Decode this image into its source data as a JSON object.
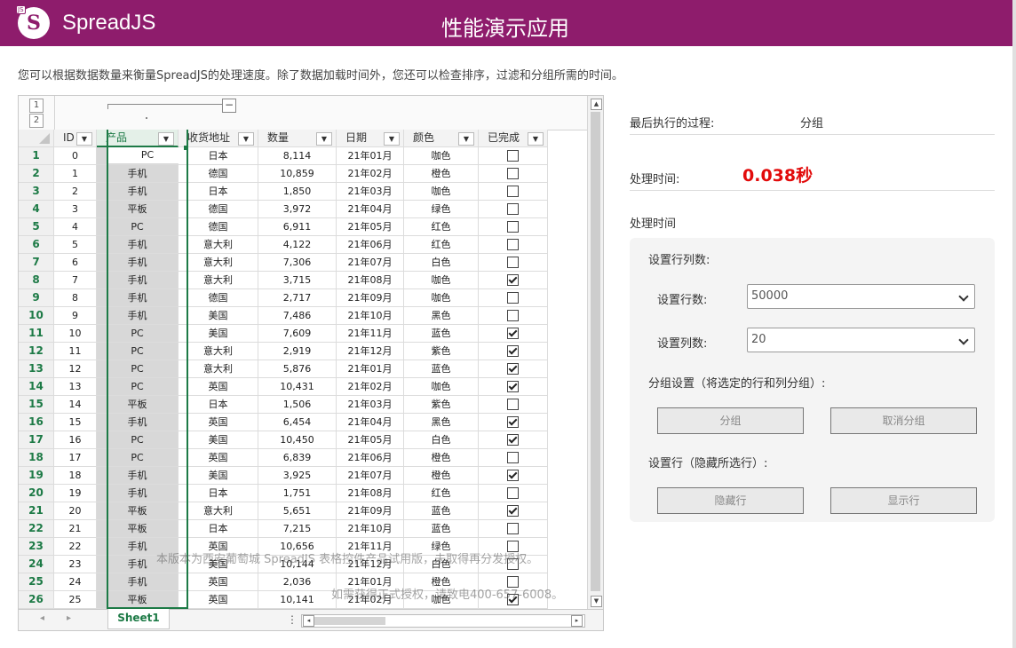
{
  "header": {
    "brand": "SpreadJS",
    "logo_badge": "JS",
    "logo_letter": "S",
    "title": "性能演示应用"
  },
  "description": "您可以根据数据数量来衡量SpreadJS的处理速度。除了数据加载时间外，您还可以检查排序，过滤和分组所需的时间。",
  "spread": {
    "group_levels": [
      "1",
      "2"
    ],
    "group_collapse": "−",
    "columns": [
      "ID",
      "产品",
      "收货地址",
      "数量",
      "日期",
      "颜色",
      "已完成"
    ],
    "selected_column": 1,
    "filter_glyph": "▼",
    "active_cell": "PC",
    "rows": [
      [
        "1",
        "0",
        "PC",
        "日本",
        "8,114",
        "21年01月",
        "咖色",
        false
      ],
      [
        "2",
        "1",
        "手机",
        "德国",
        "10,859",
        "21年02月",
        "橙色",
        false
      ],
      [
        "3",
        "2",
        "手机",
        "日本",
        "1,850",
        "21年03月",
        "咖色",
        false
      ],
      [
        "4",
        "3",
        "平板",
        "德国",
        "3,972",
        "21年04月",
        "绿色",
        false
      ],
      [
        "5",
        "4",
        "PC",
        "德国",
        "6,911",
        "21年05月",
        "红色",
        false
      ],
      [
        "6",
        "5",
        "手机",
        "意大利",
        "4,122",
        "21年06月",
        "红色",
        false
      ],
      [
        "7",
        "6",
        "手机",
        "意大利",
        "7,306",
        "21年07月",
        "白色",
        false
      ],
      [
        "8",
        "7",
        "手机",
        "意大利",
        "3,715",
        "21年08月",
        "咖色",
        true
      ],
      [
        "9",
        "8",
        "手机",
        "德国",
        "2,717",
        "21年09月",
        "咖色",
        false
      ],
      [
        "10",
        "9",
        "手机",
        "美国",
        "7,486",
        "21年10月",
        "黑色",
        false
      ],
      [
        "11",
        "10",
        "PC",
        "美国",
        "7,609",
        "21年11月",
        "蓝色",
        true
      ],
      [
        "12",
        "11",
        "PC",
        "意大利",
        "2,919",
        "21年12月",
        "紫色",
        true
      ],
      [
        "13",
        "12",
        "PC",
        "意大利",
        "5,876",
        "21年01月",
        "蓝色",
        true
      ],
      [
        "14",
        "13",
        "PC",
        "英国",
        "10,431",
        "21年02月",
        "咖色",
        true
      ],
      [
        "15",
        "14",
        "平板",
        "日本",
        "1,506",
        "21年03月",
        "紫色",
        false
      ],
      [
        "16",
        "15",
        "手机",
        "英国",
        "6,454",
        "21年04月",
        "黑色",
        true
      ],
      [
        "17",
        "16",
        "PC",
        "美国",
        "10,450",
        "21年05月",
        "白色",
        true
      ],
      [
        "18",
        "17",
        "PC",
        "英国",
        "6,839",
        "21年06月",
        "橙色",
        false
      ],
      [
        "19",
        "18",
        "手机",
        "美国",
        "3,925",
        "21年07月",
        "橙色",
        true
      ],
      [
        "20",
        "19",
        "手机",
        "日本",
        "1,751",
        "21年08月",
        "红色",
        false
      ],
      [
        "21",
        "20",
        "平板",
        "意大利",
        "5,651",
        "21年09月",
        "蓝色",
        true
      ],
      [
        "22",
        "21",
        "平板",
        "日本",
        "7,215",
        "21年10月",
        "蓝色",
        false
      ],
      [
        "23",
        "22",
        "手机",
        "英国",
        "10,656",
        "21年11月",
        "绿色",
        false
      ],
      [
        "24",
        "23",
        "手机",
        "美国",
        "10,144",
        "21年12月",
        "白色",
        false
      ],
      [
        "25",
        "24",
        "手机",
        "英国",
        "2,036",
        "21年01月",
        "橙色",
        false
      ],
      [
        "26",
        "25",
        "平板",
        "英国",
        "10,141",
        "21年02月",
        "咖色",
        true
      ]
    ],
    "sheet_tab": "Sheet1",
    "nav_prev": "◂",
    "nav_next": "▸",
    "tab_splitter": "⋮",
    "scroll_up": "▲",
    "scroll_down": "▼",
    "scroll_left": "◂",
    "scroll_right": "▸",
    "watermark_line1": "本版本为西安葡萄城 SpreadJS 表格控件产品试用版，未取得再分发授权。",
    "watermark_line2": "如需获得正式授权，请致电400-657-6008。"
  },
  "panel": {
    "last_process_label": "最后执行的过程:",
    "last_process_value": "分组",
    "process_time_label": "处理时间:",
    "process_time_value": "0.038秒",
    "section_title": "处理时间",
    "row_col_title": "设置行列数:",
    "row_count_label": "设置行数:",
    "row_count_value": "50000",
    "col_count_label": "设置列数:",
    "col_count_value": "20",
    "group_title": "分组设置（将选定的行和列分组）:",
    "group_button": "分组",
    "ungroup_button": "取消分组",
    "hide_title": "设置行（隐藏所选行）:",
    "hide_button": "隐藏行",
    "show_button": "显示行"
  },
  "colors": {
    "brand": "#8e1c6c",
    "accent": "#1d7a46",
    "time_value": "#e20b0b"
  }
}
